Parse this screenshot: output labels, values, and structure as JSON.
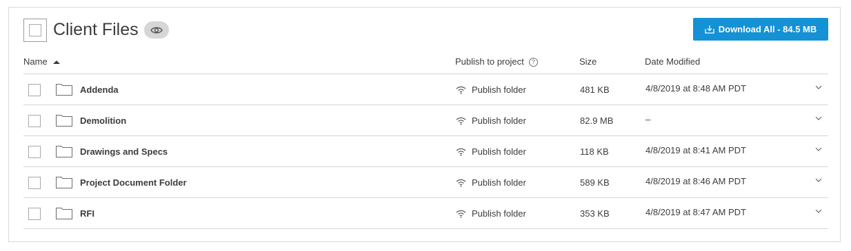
{
  "header": {
    "title": "Client Files",
    "eye_icon": "eye-icon",
    "download_label": "Download All - 84.5 MB",
    "download_icon": "download-icon",
    "accent": "#1591d5"
  },
  "columns": {
    "name": "Name",
    "publish": "Publish to project",
    "size": "Size",
    "date": "Date Modified"
  },
  "rows": [
    {
      "name": "Addenda",
      "publish": "Publish folder",
      "size": "481 KB",
      "date": "4/8/2019 at 8:48 AM PDT"
    },
    {
      "name": "Demolition",
      "publish": "Publish folder",
      "size": "82.9 MB",
      "date": "–"
    },
    {
      "name": "Drawings and Specs",
      "publish": "Publish folder",
      "size": "118 KB",
      "date": "4/8/2019 at 8:41 AM PDT"
    },
    {
      "name": "Project Document Folder",
      "publish": "Publish folder",
      "size": "589 KB",
      "date": "4/8/2019 at 8:46 AM PDT"
    },
    {
      "name": "RFI",
      "publish": "Publish folder",
      "size": "353 KB",
      "date": "4/8/2019 at 8:47 AM PDT"
    }
  ]
}
